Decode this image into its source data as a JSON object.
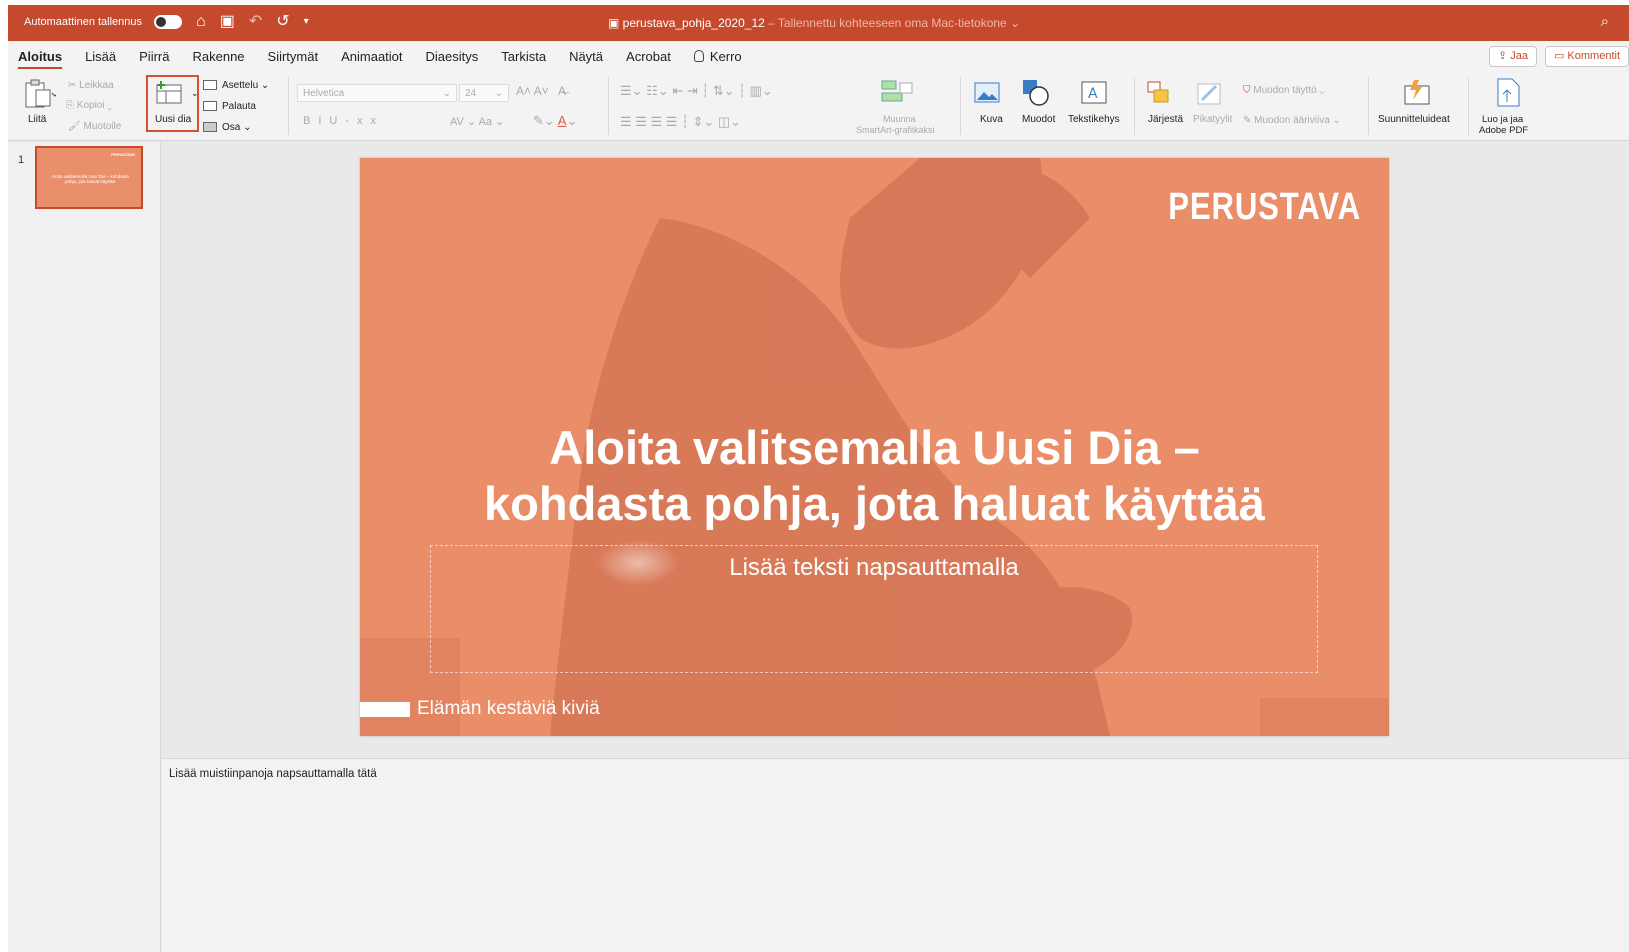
{
  "titlebar": {
    "autosave_label": "Automaattinen tallennus",
    "filename": "perustava_pohja_2020_12",
    "save_status": " – Tallennettu kohteeseen oma Mac-tietokone ⌄"
  },
  "tabs": [
    "Aloitus",
    "Lisää",
    "Piirrä",
    "Rakenne",
    "Siirtymät",
    "Animaatiot",
    "Diaesitys",
    "Tarkista",
    "Näytä",
    "Acrobat",
    "Kerro"
  ],
  "share": {
    "jaa": "Jaa",
    "kommentit": "Kommentit"
  },
  "ribbon": {
    "paste": "Liitä",
    "cut": "Leikkaa",
    "copy": "Kopioi",
    "format_painter": "Muotoile",
    "new_slide": "Uusi dia",
    "layout": "Asettelu",
    "reset": "Palauta",
    "section": "Osa",
    "font_name": "Helvetica",
    "font_size": "24",
    "smartart_1": "Muunna",
    "smartart_2": "SmartArt-grafiikaksi",
    "picture": "Kuva",
    "shapes": "Muodot",
    "textbox": "Tekstikehys",
    "arrange": "Järjestä",
    "quick_styles": "Pikatyylit",
    "shape_fill": "Muodon täyttö",
    "shape_outline": "Muodon ääriviiva",
    "designer": "Suunnitteluideat",
    "pdf_1": "Luo ja jaa",
    "pdf_2": "Adobe PDF"
  },
  "slides_panel": {
    "number": "1",
    "thumb_brand": "PERUSTAVA",
    "thumb_title": "Aloita valitsemalla Uusi Dia – kohdasta pohja, jota haluat käyttää"
  },
  "slide": {
    "brand": "PERUSTAVA",
    "title_line1": "Aloita valitsemalla Uusi Dia –",
    "title_line2": "kohdasta pohja, jota haluat käyttää",
    "subtitle": "Lisää teksti napsauttamalla",
    "footer": "Elämän kestäviä kiviä"
  },
  "notes": {
    "placeholder": "Lisää muistiinpanoja napsauttamalla tätä"
  },
  "colors": {
    "accent": "#c54a2d",
    "slide_bg": "#ea8d69"
  }
}
